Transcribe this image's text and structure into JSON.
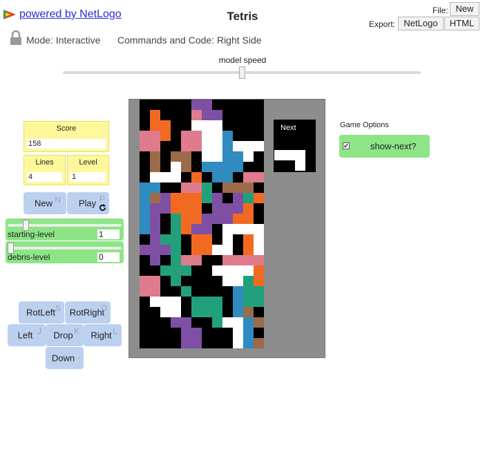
{
  "header": {
    "powered_by": "powered by NetLogo",
    "title": "Tetris",
    "file_label": "File:",
    "export_label": "Export:",
    "new_button": "New",
    "netlogo_button": "NetLogo",
    "html_button": "HTML",
    "mode": "Mode: Interactive",
    "commands": "Commands and Code: Right Side"
  },
  "speed": {
    "label": "model speed",
    "value": 0.5
  },
  "monitors": {
    "score": {
      "label": "Score",
      "value": "158"
    },
    "lines": {
      "label": "Lines",
      "value": "4"
    },
    "level": {
      "label": "Level",
      "value": "1"
    }
  },
  "buttons": {
    "new": {
      "label": "New",
      "key": "N"
    },
    "play": {
      "label": "Play",
      "key": "P"
    },
    "rotleft": {
      "label": "RotLeft",
      "key": "S"
    },
    "rotright": {
      "label": "RotRight",
      "key": "D"
    },
    "left": {
      "label": "Left",
      "key": "J"
    },
    "drop": {
      "label": "Drop",
      "key": "K"
    },
    "right": {
      "label": "Right",
      "key": "L"
    },
    "down": {
      "label": "Down",
      "key": ","
    }
  },
  "sliders": {
    "starting_level": {
      "label": "starting-level",
      "value": "1",
      "fraction": 0.14
    },
    "debris_level": {
      "label": "debris-level",
      "value": "0",
      "fraction": 0.0
    }
  },
  "game_options": {
    "label": "Game Options",
    "show_next": {
      "label": "show-next?",
      "checked": true
    }
  },
  "next_label": "Next",
  "colors": {
    "K": "#000000",
    "W": "#ffffff",
    "P": "#7e4fa3",
    "R": "#de7b8d",
    "O": "#f26a22",
    "B": "#2f8bc0",
    "N": "#9c6b49",
    "G": "#22a07c",
    "view_bg": "#8d8d8d",
    "monitor": "#fff89b",
    "button": "#bcd0f0",
    "slider": "#8de587"
  },
  "board": [
    "KKKKKPPKKKKK",
    "KOKKKRPPKKKK",
    "KOOKKWWWKKKK",
    "RROKRRWWBKKK",
    "RRKKRRWWBWWW",
    "KNKNNKWWBBWK",
    "KNKWNKBBBBKK",
    "KWWWKOKBBKRR",
    "BBKKRRGKNNNK",
    "BNPOOOGPKPGO",
    "BPPOOOKPPPOK",
    "BPKGOOPPPOOK",
    "BPKGOPPKWWWW",
    "KPGGKOOKWKOW",
    "PPPGKOOWWKOW",
    "KPKGRRKKRRRR",
    "KKGGGKKWWWWO",
    "RRKGKKKKWWGO",
    "RRKKGKKKKBGG",
    "KWWWKGGGKBGG",
    "KKWWKGGGKBNK",
    "KKKPPKKGWWBN",
    "KKKKPPKKKWBK",
    "KKKKPPKKKWBN",
    "NNKKPPKNNKKN",
    "NNKKPPKNNBBB",
    "NKKKKPPKKKKK",
    "NPKKPGGKKKKO",
    "KPPKKKGKKKOO",
    "KPPKKKGKKKOK"
  ],
  "next_piece": [
    "KKKK",
    "WWWK",
    "KKWK"
  ]
}
